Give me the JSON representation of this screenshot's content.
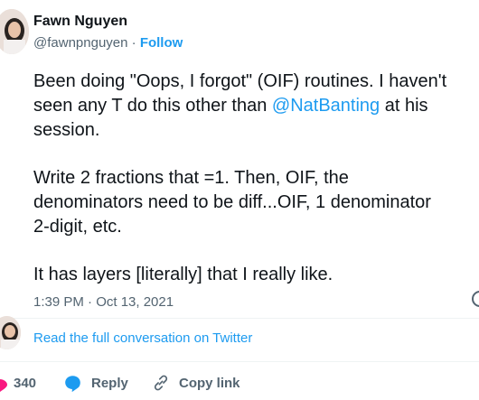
{
  "tweet": {
    "author_name": "Fawn Nguyen",
    "handle": "@fawnpnguyen",
    "separator": " · ",
    "follow_label": "Follow",
    "line1": "Been doing \"Oops, I forgot\" (OIF) routines. I haven't",
    "line2_pre": "seen any T do this other than ",
    "mention": "@NatBanting",
    "line2_post": " at his",
    "line3": "session.",
    "line4": "Write 2 fractions that =1. Then, OIF, the",
    "line5": "denominators need to be diff...OIF, 1 denominator",
    "line6": "2-digit, etc.",
    "line7": "It has layers [literally] that I really like.",
    "timestamp": "1:39 PM · Oct 13, 2021"
  },
  "conversation": {
    "read_link": "Read the full conversation on Twitter"
  },
  "actions": {
    "like_count": "340",
    "reply_label": "Reply",
    "copy_label": "Copy link"
  },
  "colors": {
    "accent": "#1d9bf0",
    "like": "#f91880",
    "text": "#0f1419",
    "muted": "#536471"
  }
}
